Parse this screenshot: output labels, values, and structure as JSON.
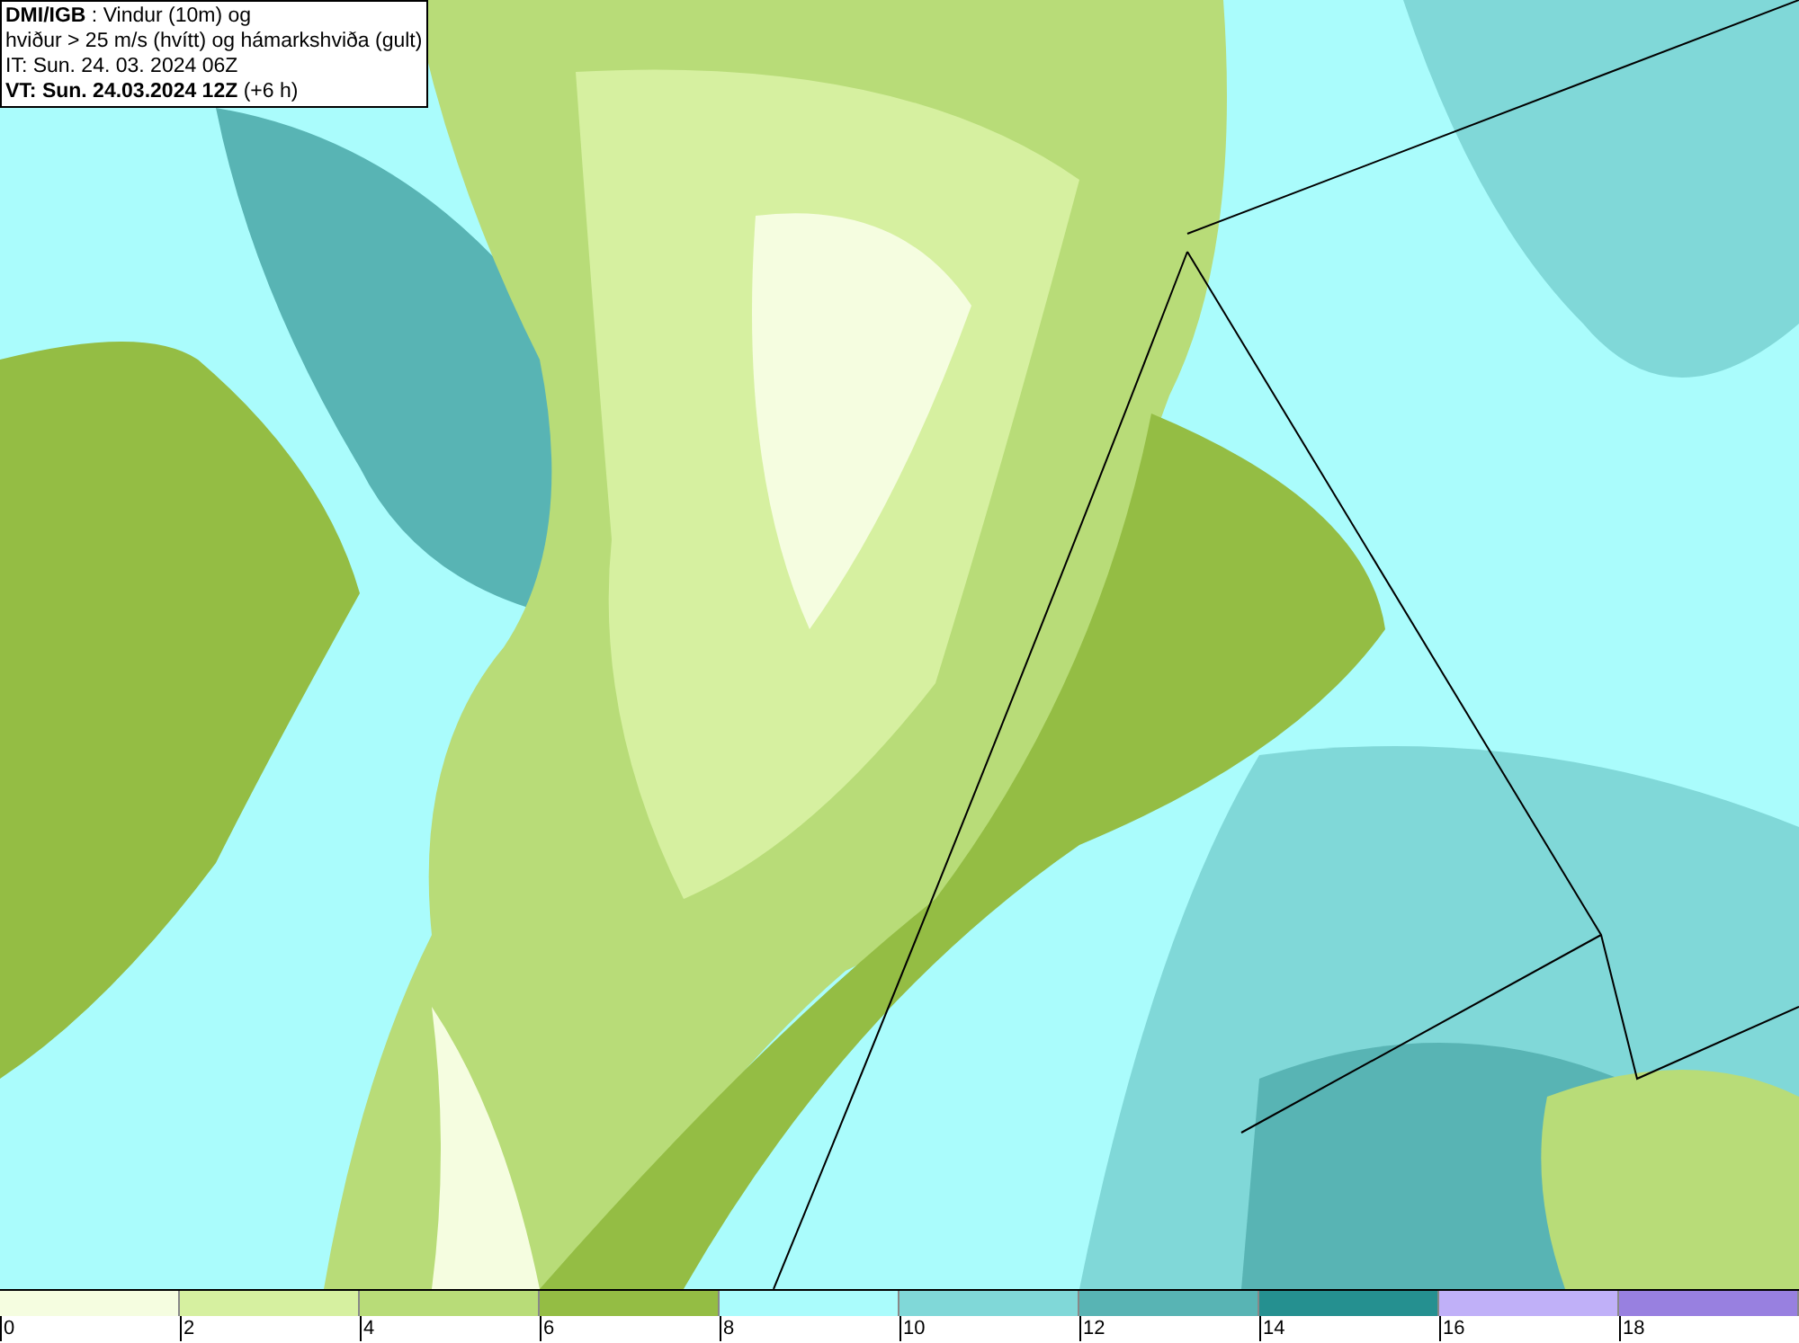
{
  "header": {
    "lines": [
      "**DMI/IGB** : Vindur (10m) og",
      "hviður > 25 m/s (hvítt) og hámarkshviða (gult)",
      "IT: Sun. 24. 03. 2024 06Z",
      "**VT: Sun. 24.03.2024 12Z** (+6 h)"
    ]
  },
  "legend": {
    "bins": [
      {
        "label": "0",
        "color": "#f5fde0"
      },
      {
        "label": "2",
        "color": "#d6f0a0"
      },
      {
        "label": "4",
        "color": "#b8dc78"
      },
      {
        "label": "6",
        "color": "#94bd44"
      },
      {
        "label": "8",
        "color": "#aafcfc"
      },
      {
        "label": "10",
        "color": "#80d8d8"
      },
      {
        "label": "12",
        "color": "#58b4b4"
      },
      {
        "label": "14",
        "color": "#259090"
      },
      {
        "label": "16",
        "color": "#c0b0f8"
      },
      {
        "label": "18",
        "color": "#9880e0"
      }
    ]
  }
}
